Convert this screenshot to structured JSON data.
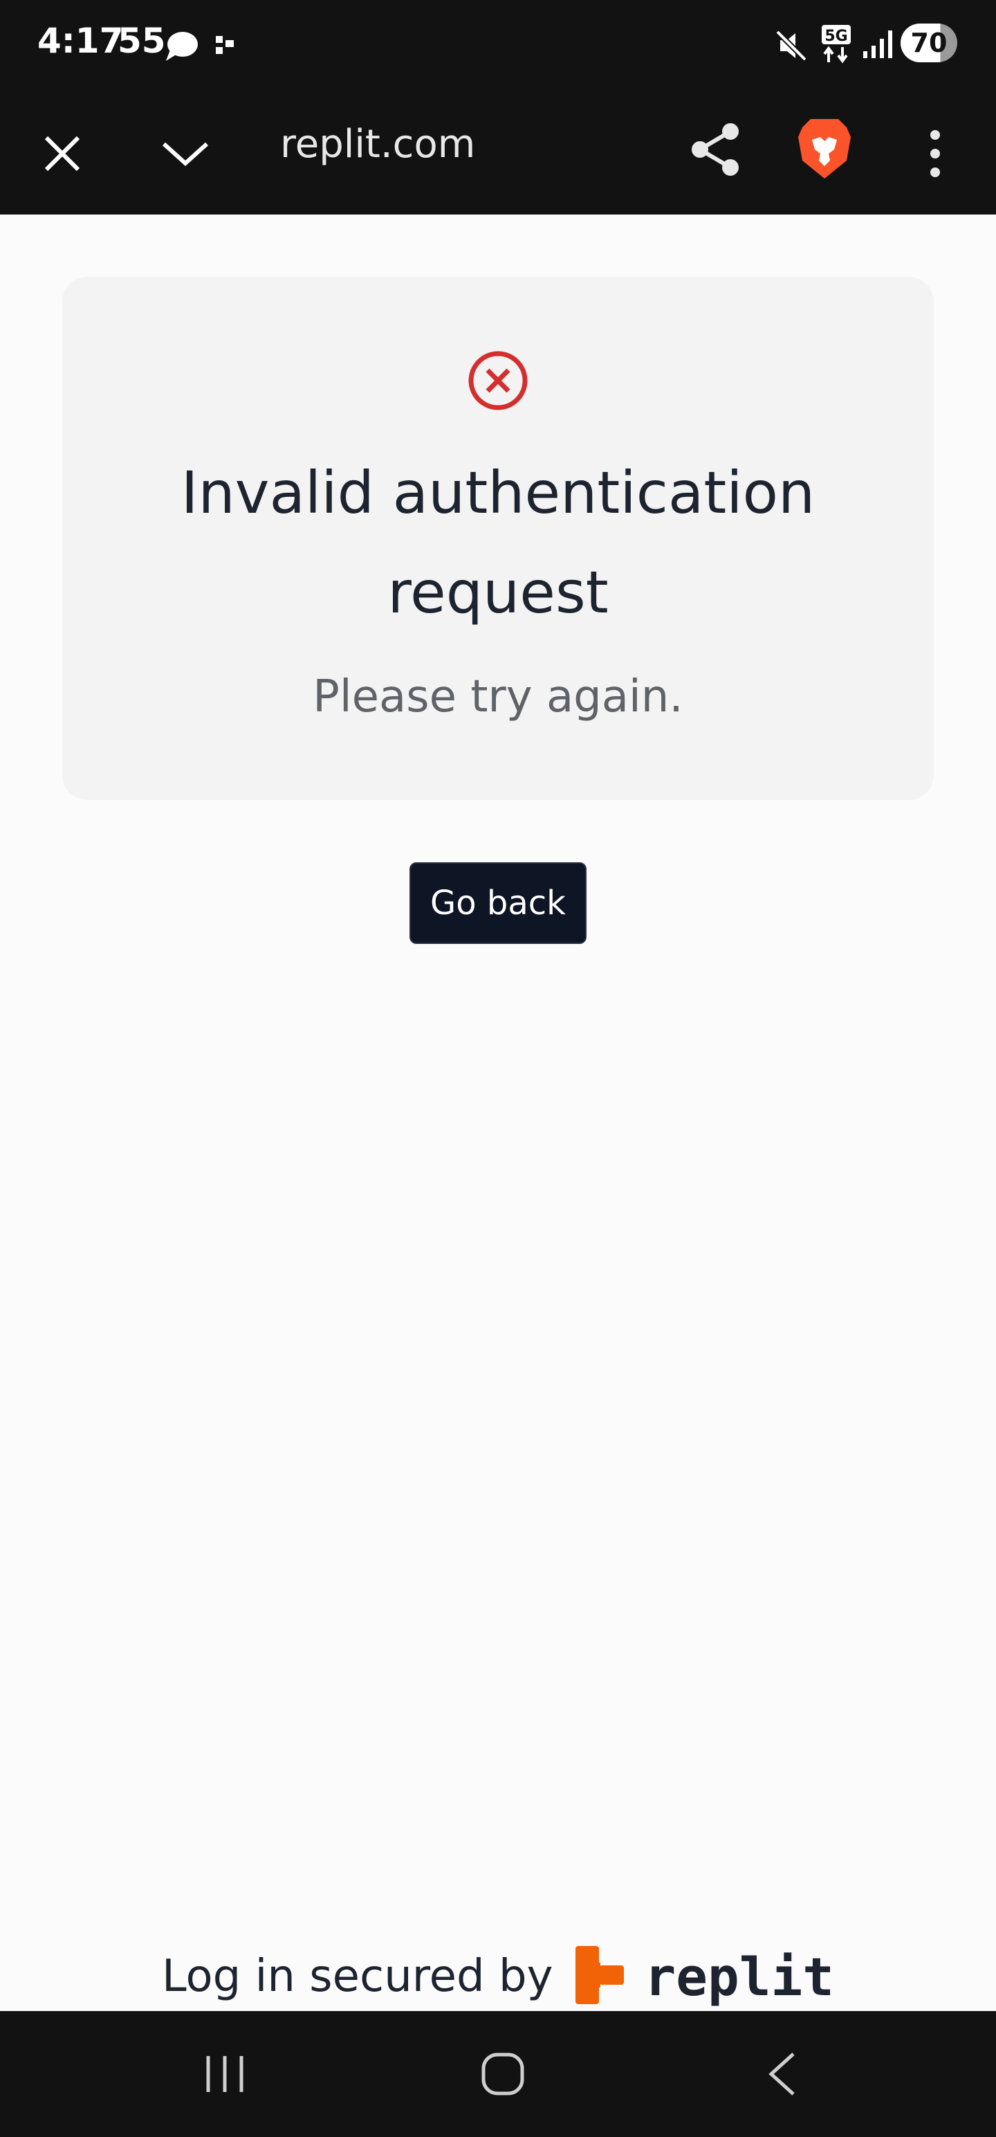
{
  "status_bar": {
    "time": "4:17",
    "extra": "55",
    "network": "5G",
    "battery": "70",
    "icons": [
      "threads-icon",
      "cast-icon",
      "mute-icon",
      "5g-icon",
      "signal-icon",
      "battery-icon"
    ]
  },
  "browser": {
    "url": "replit.com",
    "icons": [
      "close-icon",
      "chevron-down-icon",
      "share-icon",
      "brave-icon",
      "more-vertical-icon"
    ]
  },
  "error_card": {
    "icon": "error-circle-icon",
    "title": "Invalid authentication request",
    "message": "Please try again.",
    "accent_color": "#d32f2f"
  },
  "actions": {
    "go_back_label": "Go back"
  },
  "footer": {
    "text": "Log in secured by",
    "brand": "replit",
    "brand_color": "#f26207"
  },
  "nav_bar": {
    "icons": [
      "recents-icon",
      "home-icon",
      "back-icon"
    ]
  }
}
